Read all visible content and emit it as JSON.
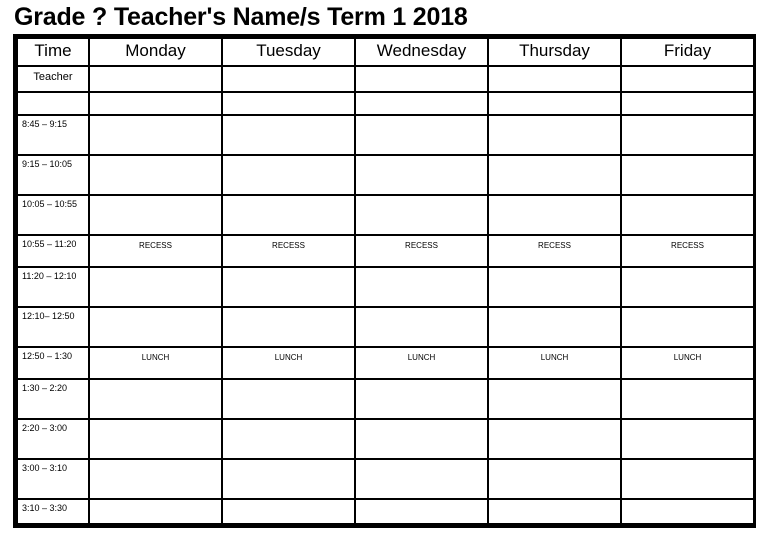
{
  "title": "Grade ? Teacher's Name/s Term 1 2018",
  "colors": {
    "shaded_row": "#c4c4c4",
    "border": "#000000",
    "cell_background": "#ffffff",
    "text": "#000000"
  },
  "table": {
    "columns": [
      {
        "key": "time",
        "label": "Time"
      },
      {
        "key": "monday",
        "label": "Monday"
      },
      {
        "key": "tuesday",
        "label": "Tuesday"
      },
      {
        "key": "wednesday",
        "label": "Wednesday"
      },
      {
        "key": "thursday",
        "label": "Thursday"
      },
      {
        "key": "friday",
        "label": "Friday"
      }
    ],
    "rows": [
      {
        "id": "teacher",
        "time": "Teacher",
        "shaded": true,
        "cells": [
          "",
          "",
          "",
          "",
          ""
        ]
      },
      {
        "id": "blank-shaded",
        "time": "",
        "shaded": true,
        "cells": [
          "",
          "",
          "",
          "",
          ""
        ]
      },
      {
        "id": "slot-1",
        "time": "8:45 – 9:15",
        "shaded": false,
        "cells": [
          "",
          "",
          "",
          "",
          ""
        ]
      },
      {
        "id": "slot-2",
        "time": "9:15 – 10:05",
        "shaded": false,
        "cells": [
          "",
          "",
          "",
          "",
          ""
        ]
      },
      {
        "id": "slot-3",
        "time": "10:05 – 10:55",
        "shaded": false,
        "cells": [
          "",
          "",
          "",
          "",
          ""
        ]
      },
      {
        "id": "recess",
        "time": "10:55 – 11:20",
        "shaded": true,
        "cells": [
          "RECESS",
          "RECESS",
          "RECESS",
          "RECESS",
          "RECESS"
        ]
      },
      {
        "id": "slot-4",
        "time": "11:20 – 12:10",
        "shaded": false,
        "cells": [
          "",
          "",
          "",
          "",
          ""
        ]
      },
      {
        "id": "slot-5",
        "time": "12:10– 12:50",
        "shaded": false,
        "cells": [
          "",
          "",
          "",
          "",
          ""
        ]
      },
      {
        "id": "lunch",
        "time": "12:50 – 1:30",
        "shaded": true,
        "cells": [
          "LUNCH",
          "LUNCH",
          "LUNCH",
          "LUNCH",
          "LUNCH"
        ]
      },
      {
        "id": "slot-6",
        "time": "1:30 – 2:20",
        "shaded": false,
        "cells": [
          "",
          "",
          "",
          "",
          ""
        ]
      },
      {
        "id": "slot-7",
        "time": "2:20 – 3:00",
        "shaded": false,
        "cells": [
          "",
          "",
          "",
          "",
          ""
        ]
      },
      {
        "id": "slot-8",
        "time": "3:00 – 3:10",
        "shaded": false,
        "cells": [
          "",
          "",
          "",
          "",
          ""
        ]
      },
      {
        "id": "pack-up",
        "time": "3:10 – 3:30",
        "shaded": true,
        "cells": [
          "",
          "",
          "",
          "",
          ""
        ]
      }
    ]
  }
}
